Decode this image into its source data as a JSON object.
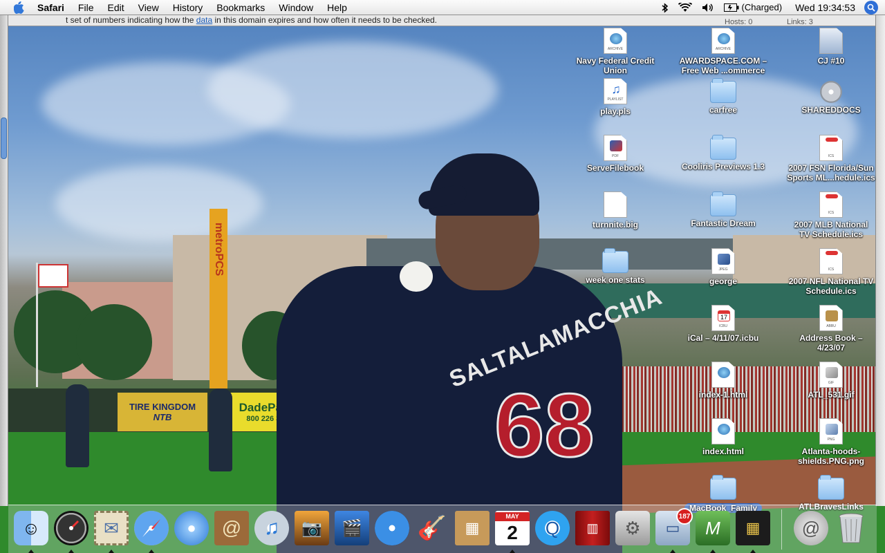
{
  "menubar": {
    "app_name": "Safari",
    "menus": [
      "File",
      "Edit",
      "View",
      "History",
      "Bookmarks",
      "Window",
      "Help"
    ],
    "battery_status": "(Charged)",
    "clock": "Wed 19:34:53"
  },
  "background_window": {
    "text_before": "t set of numbers indicating how the ",
    "link": "data",
    "text_after": " in this domain expires and how often it needs to be checked.",
    "header_left": "Hosts: 0",
    "header_right": "Links: 3"
  },
  "desktop": {
    "icons": [
      {
        "label": "Navy Federal Credit\nUnion",
        "icon": "webloc-archive-icon",
        "tag": "ARCHIVE"
      },
      {
        "label": "AWARDSPACE.COM –\nFree Web ...ommerce",
        "icon": "webloc-archive-icon",
        "tag": "ARCHIVE"
      },
      {
        "label": "CJ #10",
        "icon": "disk-image-icon",
        "tag": ""
      },
      {
        "label": "play.pls",
        "icon": "playlist-icon",
        "tag": "PLAYLIST"
      },
      {
        "label": "carfree",
        "icon": "folder-icon",
        "tag": ""
      },
      {
        "label": "SHAREDDOCS",
        "icon": "shared-disk-icon",
        "tag": ""
      },
      {
        "label": "ServeFilebook",
        "icon": "pdf-icon",
        "tag": "PDF"
      },
      {
        "label": "Cooliris Previews 1.3",
        "icon": "folder-icon",
        "tag": ""
      },
      {
        "label": "2007 FSN Florida/Sun\nSports ML...hedule.ics",
        "icon": "ics-icon",
        "tag": "ICS"
      },
      {
        "label": "turnnite.big",
        "icon": "document-icon",
        "tag": ""
      },
      {
        "label": "Fantastic Dream",
        "icon": "folder-icon",
        "tag": ""
      },
      {
        "label": "2007 MLB National\nTV Schedule.ics",
        "icon": "ics-icon",
        "tag": "ICS"
      },
      {
        "label": "week one stats",
        "icon": "folder-icon",
        "tag": ""
      },
      {
        "label": "george",
        "icon": "jpeg-icon",
        "tag": "JPEG"
      },
      {
        "label": "2007 NFL National TV\nSchedule.ics",
        "icon": "ics-icon",
        "tag": "ICS"
      },
      {
        "label": "iCal – 4/11/07.icbu",
        "icon": "ical-backup-icon",
        "tag": "ICBU"
      },
      {
        "label": "Address Book –\n4/23/07",
        "icon": "address-book-backup-icon",
        "tag": "ABBU"
      },
      {
        "label": "index-1.html",
        "icon": "html-file-icon",
        "tag": ""
      },
      {
        "label": "ATL_531.gif",
        "icon": "gif-icon",
        "tag": "GIF"
      },
      {
        "label": "index.html",
        "icon": "html-file-icon",
        "tag": ""
      },
      {
        "label": "Atlanta-hoods-\nshields.PNG.png",
        "icon": "png-icon",
        "tag": "PNG"
      },
      {
        "label": "MacBook_Family",
        "icon": "folder-icon",
        "tag": ""
      },
      {
        "label": "ATLBravesLinks",
        "icon": "folder-icon",
        "tag": ""
      }
    ]
  },
  "dock": {
    "items": [
      {
        "name": "Finder",
        "icon": "finder-icon"
      },
      {
        "name": "Dashboard",
        "icon": "dashboard-icon"
      },
      {
        "name": "Mail",
        "icon": "mail-stamp-icon"
      },
      {
        "name": "Safari",
        "icon": "safari-compass-icon"
      },
      {
        "name": "iChat",
        "icon": "ichat-bubble-icon"
      },
      {
        "name": "Address Book",
        "icon": "address-book-icon"
      },
      {
        "name": "iTunes",
        "icon": "itunes-note-icon"
      },
      {
        "name": "iPhoto",
        "icon": "iphoto-icon"
      },
      {
        "name": "iMovie",
        "icon": "imovie-clapper-icon"
      },
      {
        "name": "iDVD",
        "icon": "idvd-disc-icon"
      },
      {
        "name": "GarageBand",
        "icon": "garageband-guitar-icon"
      },
      {
        "name": "iWeb",
        "icon": "iweb-icon"
      },
      {
        "name": "iCal",
        "icon": "ical-calendar-icon"
      },
      {
        "name": "QuickTime Player",
        "icon": "quicktime-icon"
      },
      {
        "name": "Photo Booth",
        "icon": "photo-booth-icon"
      },
      {
        "name": "System Preferences",
        "icon": "system-preferences-icon"
      },
      {
        "name": "Preview",
        "icon": "preview-icon"
      },
      {
        "name": "TextMate",
        "icon": "text-editor-icon"
      },
      {
        "name": "Stacks",
        "icon": "stack-grid-icon"
      },
      {
        "name": "Mail Downloads",
        "icon": "downloads-icon"
      },
      {
        "name": "Trash",
        "icon": "trash-icon"
      }
    ],
    "ical_month": "MAY",
    "ical_day": "2",
    "preview_badge": "187"
  },
  "wallpaper": {
    "jersey_name": "SALTALAMACCHIA",
    "jersey_number": "68",
    "ad_tire_kingdom": "TIRE KINGDOM",
    "ad_ntb": "NTB",
    "ad_dade_paper": "DadePaper",
    "ad_phone": "800 226 3233",
    "pole_text": "metroPCS"
  }
}
